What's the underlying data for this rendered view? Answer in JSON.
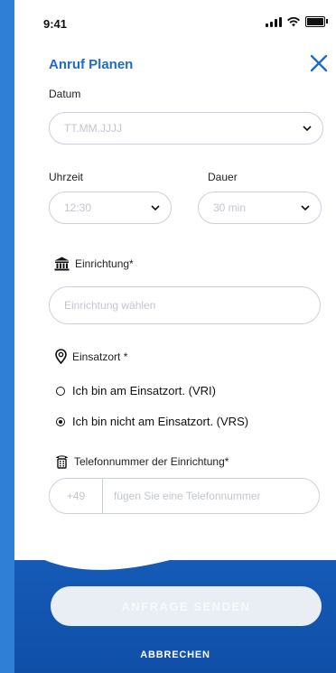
{
  "status_bar": {
    "time": "9:41"
  },
  "header": {
    "title": "Anruf Planen",
    "close_icon": "close-icon"
  },
  "date": {
    "label": "Datum",
    "placeholder": "TT.MM.JJJJ"
  },
  "time": {
    "label": "Uhrzeit",
    "value": "12:30"
  },
  "duration": {
    "label": "Dauer",
    "value": "30 min"
  },
  "facility": {
    "label": "Einrichtung*",
    "placeholder": "Einrichtung wählen",
    "icon": "institution-icon"
  },
  "location": {
    "label": "Einsatzort *",
    "icon": "location-pin-icon",
    "options": [
      {
        "label": "Ich bin am Einsatzort. (VRI)",
        "selected": false
      },
      {
        "label": "Ich bin nicht am Einsatzort. (VRS)",
        "selected": true
      }
    ]
  },
  "phone": {
    "label": "Telefonnummer der Einrichtung*",
    "prefix": "+49",
    "placeholder": "fügen Sie eine Telefonnummer",
    "icon": "telephone-icon"
  },
  "actions": {
    "send_label": "ANFRAGE SENDEN",
    "cancel_label": "ABBRECHEN"
  },
  "colors": {
    "accent": "#1e6cc7",
    "background_blue": "#2c86e6",
    "border": "#c9d2dc"
  }
}
